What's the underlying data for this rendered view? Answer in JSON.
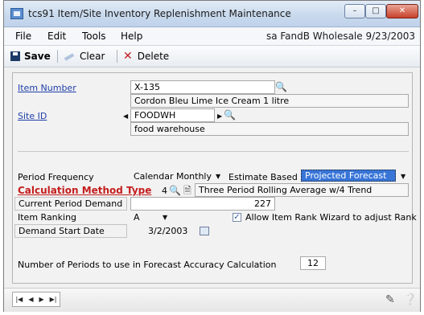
{
  "window": {
    "title": "tcs91 Item/Site Inventory Replenishment Maintenance",
    "controls": {
      "minimize": "–",
      "maximize": "□",
      "close": "✕"
    }
  },
  "menu": {
    "items": [
      "File",
      "Edit",
      "Tools",
      "Help"
    ],
    "status": "sa  FandB Wholesale  9/23/2003"
  },
  "toolbar": {
    "save_label": "Save",
    "clear_label": "Clear",
    "delete_label": "Delete"
  },
  "form": {
    "item_number": {
      "label": "Item Number",
      "value": "X-135",
      "description": "Cordon Bleu Lime  Ice Cream 1 litre"
    },
    "site_id": {
      "label": "Site ID",
      "value": "FOODWH",
      "description": "food warehouse"
    },
    "period_frequency": {
      "label": "Period Frequency",
      "value": "Calendar Monthly"
    },
    "estimate_based_on": {
      "label": "Estimate Based on",
      "value": "Projected Forecast"
    },
    "calculation_method": {
      "label": "Calculation Method Type",
      "code": "4",
      "description": "Three Period Rolling Average w/4 Trend"
    },
    "current_period_demand": {
      "label": "Current Period Demand",
      "value": "227"
    },
    "item_ranking": {
      "label": "Item Ranking",
      "value": "A"
    },
    "allow_rank_wizard": {
      "label": "Allow Item Rank Wizard to adjust Rank",
      "checked": true
    },
    "demand_start_date": {
      "label": "Demand Start Date",
      "value": "3/2/2003"
    },
    "forecast_periods": {
      "label": "Number of Periods to use in  Forecast Accuracy Calculation",
      "value": "12"
    }
  },
  "icons": {
    "lookup": "magnifier-icon",
    "note": "note-icon",
    "calendar": "calendar-icon",
    "help": "help-icon"
  },
  "colors": {
    "accent": "#3875d7",
    "link": "#1f3fa8",
    "required_link": "#c51d1d"
  }
}
